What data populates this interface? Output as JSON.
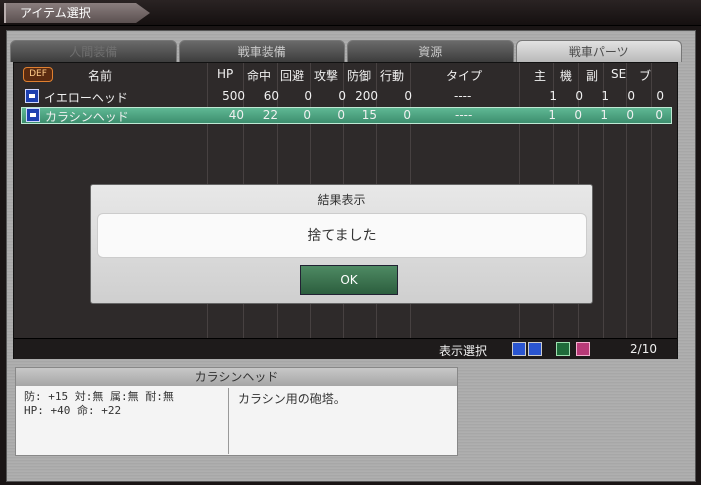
{
  "window": {
    "title": "アイテム選択"
  },
  "tabs": [
    {
      "label": "人間装備",
      "state": "dim"
    },
    {
      "label": "戦車装備",
      "state": "normal"
    },
    {
      "label": "資源",
      "state": "normal"
    },
    {
      "label": "戦車パーツ",
      "state": "active"
    }
  ],
  "list": {
    "def_badge": "DEF",
    "headers": {
      "name": "名前",
      "hp": "HP",
      "hit": "命中",
      "evade": "回避",
      "attack": "攻撃",
      "defense": "防御",
      "action": "行動",
      "type": "タイプ",
      "main": "主",
      "machine": "機",
      "sub": "副",
      "se": "SE",
      "bu": "ブ"
    },
    "rows": [
      {
        "name": "イエローヘッド",
        "hp": "500",
        "hit": "60",
        "evade": "0",
        "attack": "0",
        "defense": "200",
        "action": "0",
        "type": "----",
        "main": "1",
        "machine": "0",
        "sub": "1",
        "se": "0",
        "bu": "0"
      },
      {
        "name": "カラシンヘッド",
        "hp": "40",
        "hit": "22",
        "evade": "0",
        "attack": "0",
        "defense": "15",
        "action": "0",
        "type": "----",
        "main": "1",
        "machine": "0",
        "sub": "1",
        "se": "0",
        "bu": "0"
      }
    ]
  },
  "footer": {
    "display_select_label": "表示選択",
    "page": "2/10"
  },
  "info": {
    "title": "カラシンヘッド",
    "stats_line1": "防: +15 対:無 属:無 耐:無",
    "stats_line2": "HP: +40 命: +22",
    "description": "カラシン用の砲塔。"
  },
  "dialog": {
    "title": "結果表示",
    "message": "捨てました",
    "ok_label": "OK"
  },
  "icons": {
    "part_icon": "tank-part-icon",
    "filter_icons": [
      "tank-icon",
      "ammo-icon",
      "on-toggle-icon",
      "equip-icon"
    ]
  }
}
